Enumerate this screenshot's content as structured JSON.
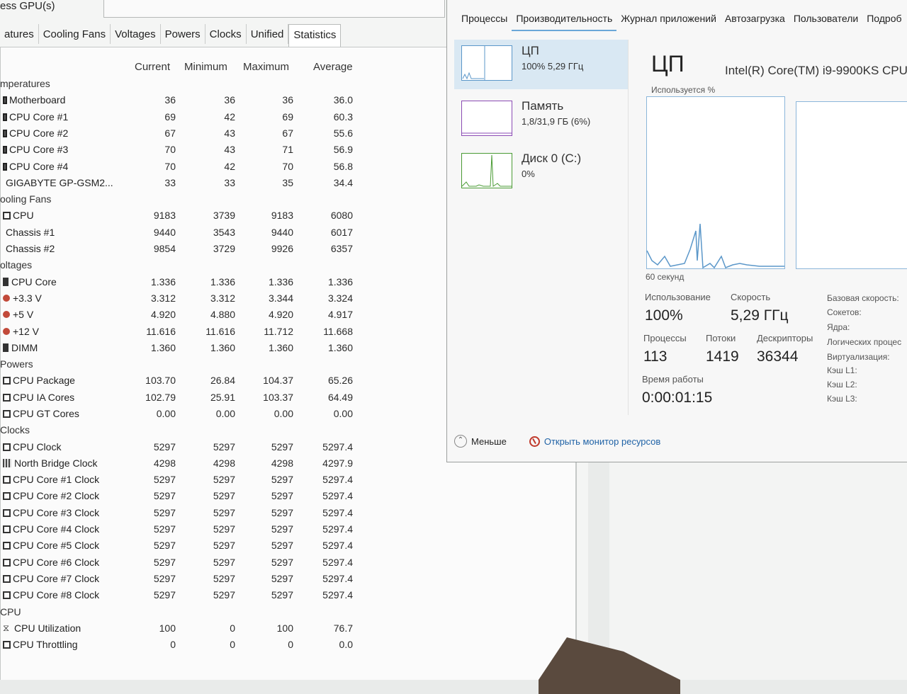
{
  "hw": {
    "title": "ess GPU(s)",
    "tabs": [
      "atures",
      "Cooling Fans",
      "Voltages",
      "Powers",
      "Clocks",
      "Unified",
      "Statistics"
    ],
    "active_tab": 6,
    "columns": [
      "Current",
      "Minimum",
      "Maximum",
      "Average"
    ],
    "rows": [
      {
        "kind": "group",
        "label": "mperatures"
      },
      {
        "kind": "item",
        "icon": "temp",
        "label": "Motherboard",
        "v": [
          "36",
          "36",
          "36",
          "36.0"
        ]
      },
      {
        "kind": "item",
        "icon": "temp",
        "label": "CPU Core #1",
        "v": [
          "69",
          "42",
          "69",
          "60.3"
        ]
      },
      {
        "kind": "item",
        "icon": "temp",
        "label": "CPU Core #2",
        "v": [
          "67",
          "43",
          "67",
          "55.6"
        ]
      },
      {
        "kind": "item",
        "icon": "temp",
        "label": "CPU Core #3",
        "v": [
          "70",
          "43",
          "71",
          "56.9"
        ]
      },
      {
        "kind": "item",
        "icon": "temp",
        "label": "CPU Core #4",
        "v": [
          "70",
          "42",
          "70",
          "56.8"
        ]
      },
      {
        "kind": "item",
        "icon": "none",
        "label": "GIGABYTE GP-GSM2...",
        "v": [
          "33",
          "33",
          "35",
          "34.4"
        ]
      },
      {
        "kind": "group",
        "label": "ooling Fans"
      },
      {
        "kind": "item",
        "icon": "fan",
        "label": "CPU",
        "v": [
          "9183",
          "3739",
          "9183",
          "6080"
        ]
      },
      {
        "kind": "item",
        "icon": "none",
        "label": "Chassis #1",
        "v": [
          "9440",
          "3543",
          "9440",
          "6017"
        ]
      },
      {
        "kind": "item",
        "icon": "none",
        "label": "Chassis #2",
        "v": [
          "9854",
          "3729",
          "9926",
          "6357"
        ]
      },
      {
        "kind": "group",
        "label": "oltages"
      },
      {
        "kind": "item",
        "icon": "bar",
        "label": "CPU Core",
        "v": [
          "1.336",
          "1.336",
          "1.336",
          "1.336"
        ]
      },
      {
        "kind": "item",
        "icon": "circ",
        "label": "+3.3 V",
        "v": [
          "3.312",
          "3.312",
          "3.344",
          "3.324"
        ]
      },
      {
        "kind": "item",
        "icon": "circ",
        "label": "+5 V",
        "v": [
          "4.920",
          "4.880",
          "4.920",
          "4.917"
        ]
      },
      {
        "kind": "item",
        "icon": "circ",
        "label": "+12 V",
        "v": [
          "11.616",
          "11.616",
          "11.712",
          "11.668"
        ]
      },
      {
        "kind": "item",
        "icon": "bar",
        "label": "DIMM",
        "v": [
          "1.360",
          "1.360",
          "1.360",
          "1.360"
        ]
      },
      {
        "kind": "group",
        "label": "Powers"
      },
      {
        "kind": "item",
        "icon": "sq",
        "label": "CPU Package",
        "v": [
          "103.70",
          "26.84",
          "104.37",
          "65.26"
        ]
      },
      {
        "kind": "item",
        "icon": "sq",
        "label": "CPU IA Cores",
        "v": [
          "102.79",
          "25.91",
          "103.37",
          "64.49"
        ]
      },
      {
        "kind": "item",
        "icon": "sq",
        "label": "CPU GT Cores",
        "v": [
          "0.00",
          "0.00",
          "0.00",
          "0.00"
        ]
      },
      {
        "kind": "group",
        "label": "Clocks"
      },
      {
        "kind": "item",
        "icon": "sq",
        "label": "CPU Clock",
        "v": [
          "5297",
          "5297",
          "5297",
          "5297.4"
        ]
      },
      {
        "kind": "item",
        "icon": "nb",
        "label": "North Bridge Clock",
        "v": [
          "4298",
          "4298",
          "4298",
          "4297.9"
        ]
      },
      {
        "kind": "item",
        "icon": "sq",
        "label": "CPU Core #1 Clock",
        "v": [
          "5297",
          "5297",
          "5297",
          "5297.4"
        ]
      },
      {
        "kind": "item",
        "icon": "sq",
        "label": "CPU Core #2 Clock",
        "v": [
          "5297",
          "5297",
          "5297",
          "5297.4"
        ]
      },
      {
        "kind": "item",
        "icon": "sq",
        "label": "CPU Core #3 Clock",
        "v": [
          "5297",
          "5297",
          "5297",
          "5297.4"
        ]
      },
      {
        "kind": "item",
        "icon": "sq",
        "label": "CPU Core #4 Clock",
        "v": [
          "5297",
          "5297",
          "5297",
          "5297.4"
        ]
      },
      {
        "kind": "item",
        "icon": "sq",
        "label": "CPU Core #5 Clock",
        "v": [
          "5297",
          "5297",
          "5297",
          "5297.4"
        ]
      },
      {
        "kind": "item",
        "icon": "sq",
        "label": "CPU Core #6 Clock",
        "v": [
          "5297",
          "5297",
          "5297",
          "5297.4"
        ]
      },
      {
        "kind": "item",
        "icon": "sq",
        "label": "CPU Core #7 Clock",
        "v": [
          "5297",
          "5297",
          "5297",
          "5297.4"
        ]
      },
      {
        "kind": "item",
        "icon": "sq",
        "label": "CPU Core #8 Clock",
        "v": [
          "5297",
          "5297",
          "5297",
          "5297.4"
        ]
      },
      {
        "kind": "group",
        "label": "CPU"
      },
      {
        "kind": "item",
        "icon": "hourglass",
        "label": "CPU Utilization",
        "v": [
          "100",
          "0",
          "100",
          "76.7"
        ]
      },
      {
        "kind": "item",
        "icon": "sq",
        "label": "CPU Throttling",
        "v": [
          "0",
          "0",
          "0",
          "0.0"
        ]
      }
    ]
  },
  "tm": {
    "tabs": [
      "Процессы",
      "Производительность",
      "Журнал приложений",
      "Автозагрузка",
      "Пользователи",
      "Подроб"
    ],
    "active_tab": 1,
    "resources": [
      {
        "name": "ЦП",
        "sub": "100%  5,29 ГГц",
        "type": "cpu",
        "active": true
      },
      {
        "name": "Память",
        "sub": "1,8/31,9 ГБ (6%)",
        "type": "mem",
        "active": false
      },
      {
        "name": "Диск 0 (C:)",
        "sub": "0%",
        "type": "disk",
        "active": false
      }
    ],
    "title": "ЦП",
    "cpu_model": "Intel(R) Core(TM) i9-9900KS CPU",
    "graph_label": "Используется %",
    "graph_time": "60 секунд",
    "stats": {
      "usage_label": "Использование",
      "usage": "100%",
      "speed_label": "Скорость",
      "speed": "5,29 ГГц",
      "proc_label": "Процессы",
      "proc": "113",
      "threads_label": "Потоки",
      "threads": "1419",
      "handles_label": "Дескрипторы",
      "handles": "36344",
      "uptime_label": "Время работы",
      "uptime": "0:00:01:15"
    },
    "side_labels": [
      "Базовая скорость:",
      "Сокетов:",
      "Ядра:",
      "Логических процес",
      "Виртуализация:",
      "Кэш L1:",
      "Кэш L2:",
      "Кэш L3:"
    ],
    "less_label": "Меньше",
    "monitor_link": "Открыть монитор ресурсов"
  },
  "colors": {
    "cpu": "#5b97c9",
    "mem": "#8b4bb4",
    "disk": "#4a9b34"
  }
}
